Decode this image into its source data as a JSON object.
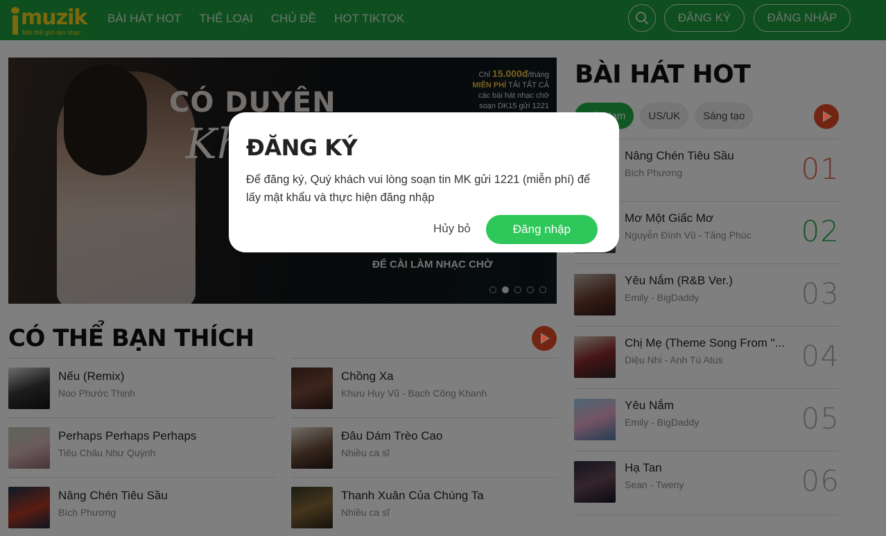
{
  "header": {
    "logo_text": "muzik",
    "logo_tagline": "Một thế giới âm nhạc",
    "nav": [
      "BÀI HÁT HOT",
      "THỂ LOẠI",
      "CHỦ ĐỀ",
      "HOT TIKTOK"
    ],
    "register_label": "ĐĂNG KÝ",
    "login_label": "ĐĂNG NHẬP"
  },
  "banner": {
    "title_line1": "CÓ DUYÊN",
    "title_line2": "Kh",
    "promo_line1_prefix": "Chỉ ",
    "promo_price": "15.000đ",
    "promo_line1_suffix": "/tháng",
    "promo_line2_bold": "MIỄN PHÍ",
    "promo_line2": " TẢI TẤT CẢ",
    "promo_line3": "các bài hát nhạc chờ",
    "promo_line4": "soạn DK15 gửi 1221",
    "cta": "ĐỂ CÀI LÀM NHẠC CHỜ",
    "active_slide": 2,
    "slide_count": 5
  },
  "suggestions": {
    "title": "CÓ THỂ BẠN THÍCH",
    "left": [
      {
        "name": "Nếu (Remix)",
        "artist": "Noo Phước Thịnh"
      },
      {
        "name": "Perhaps Perhaps Perhaps",
        "artist": "Tiêu Châu Như Quỳnh"
      },
      {
        "name": "Nâng Chén Tiêu Sầu",
        "artist": "Bích Phương"
      }
    ],
    "right": [
      {
        "name": "Chồng Xa",
        "artist": "Khưu Huy Vũ - Bạch Công Khanh"
      },
      {
        "name": "Đâu Dám Trèo Cao",
        "artist": "Nhiều ca sĩ"
      },
      {
        "name": "Thanh Xuân Của Chúng Ta",
        "artist": "Nhiều ca sĩ"
      }
    ]
  },
  "hot": {
    "title": "BÀI HÁT HOT",
    "tabs": [
      "Việt Nam",
      "US/UK",
      "Sáng tạo"
    ],
    "songs": [
      {
        "name": "Nâng Chén Tiêu Sầu",
        "artist": "Bích Phương",
        "rank": "01",
        "rank_color": "#d9614a"
      },
      {
        "name": "Mơ Một Giấc Mơ",
        "artist": "Nguyễn Đình Vũ - Tăng Phúc",
        "rank": "02",
        "rank_color": "#2ea84f"
      },
      {
        "name": "Yêu Nắm (R&B Ver.)",
        "artist": "Emily - BigDaddy",
        "rank": "03",
        "rank_color": "#aaaaaa"
      },
      {
        "name": "Chị Mẹ (Theme Song From \"...",
        "artist": "Diệu Nhi - Anh Tú Atus",
        "rank": "04",
        "rank_color": "#aaaaaa"
      },
      {
        "name": "Yêu Nắm",
        "artist": "Emily - BigDaddy",
        "rank": "05",
        "rank_color": "#aaaaaa"
      },
      {
        "name": "Hạ Tan",
        "artist": "Sean - Tweny",
        "rank": "06",
        "rank_color": "#aaaaaa"
      }
    ]
  },
  "modal": {
    "title": "ĐĂNG KÝ",
    "body": "Để đăng ký, Quý khách vui lòng soạn tin MK gửi 1221 (miễn phí) để lấy mật khẩu và thực hiện đăng nhập",
    "cancel_label": "Hủy bỏ",
    "login_label": "Đăng nhập"
  },
  "colors": {
    "header_green": "#1e9e3e",
    "accent_green": "#2ec75a",
    "play_orange": "#e24a25",
    "logo_yellow": "#f6d21d"
  }
}
